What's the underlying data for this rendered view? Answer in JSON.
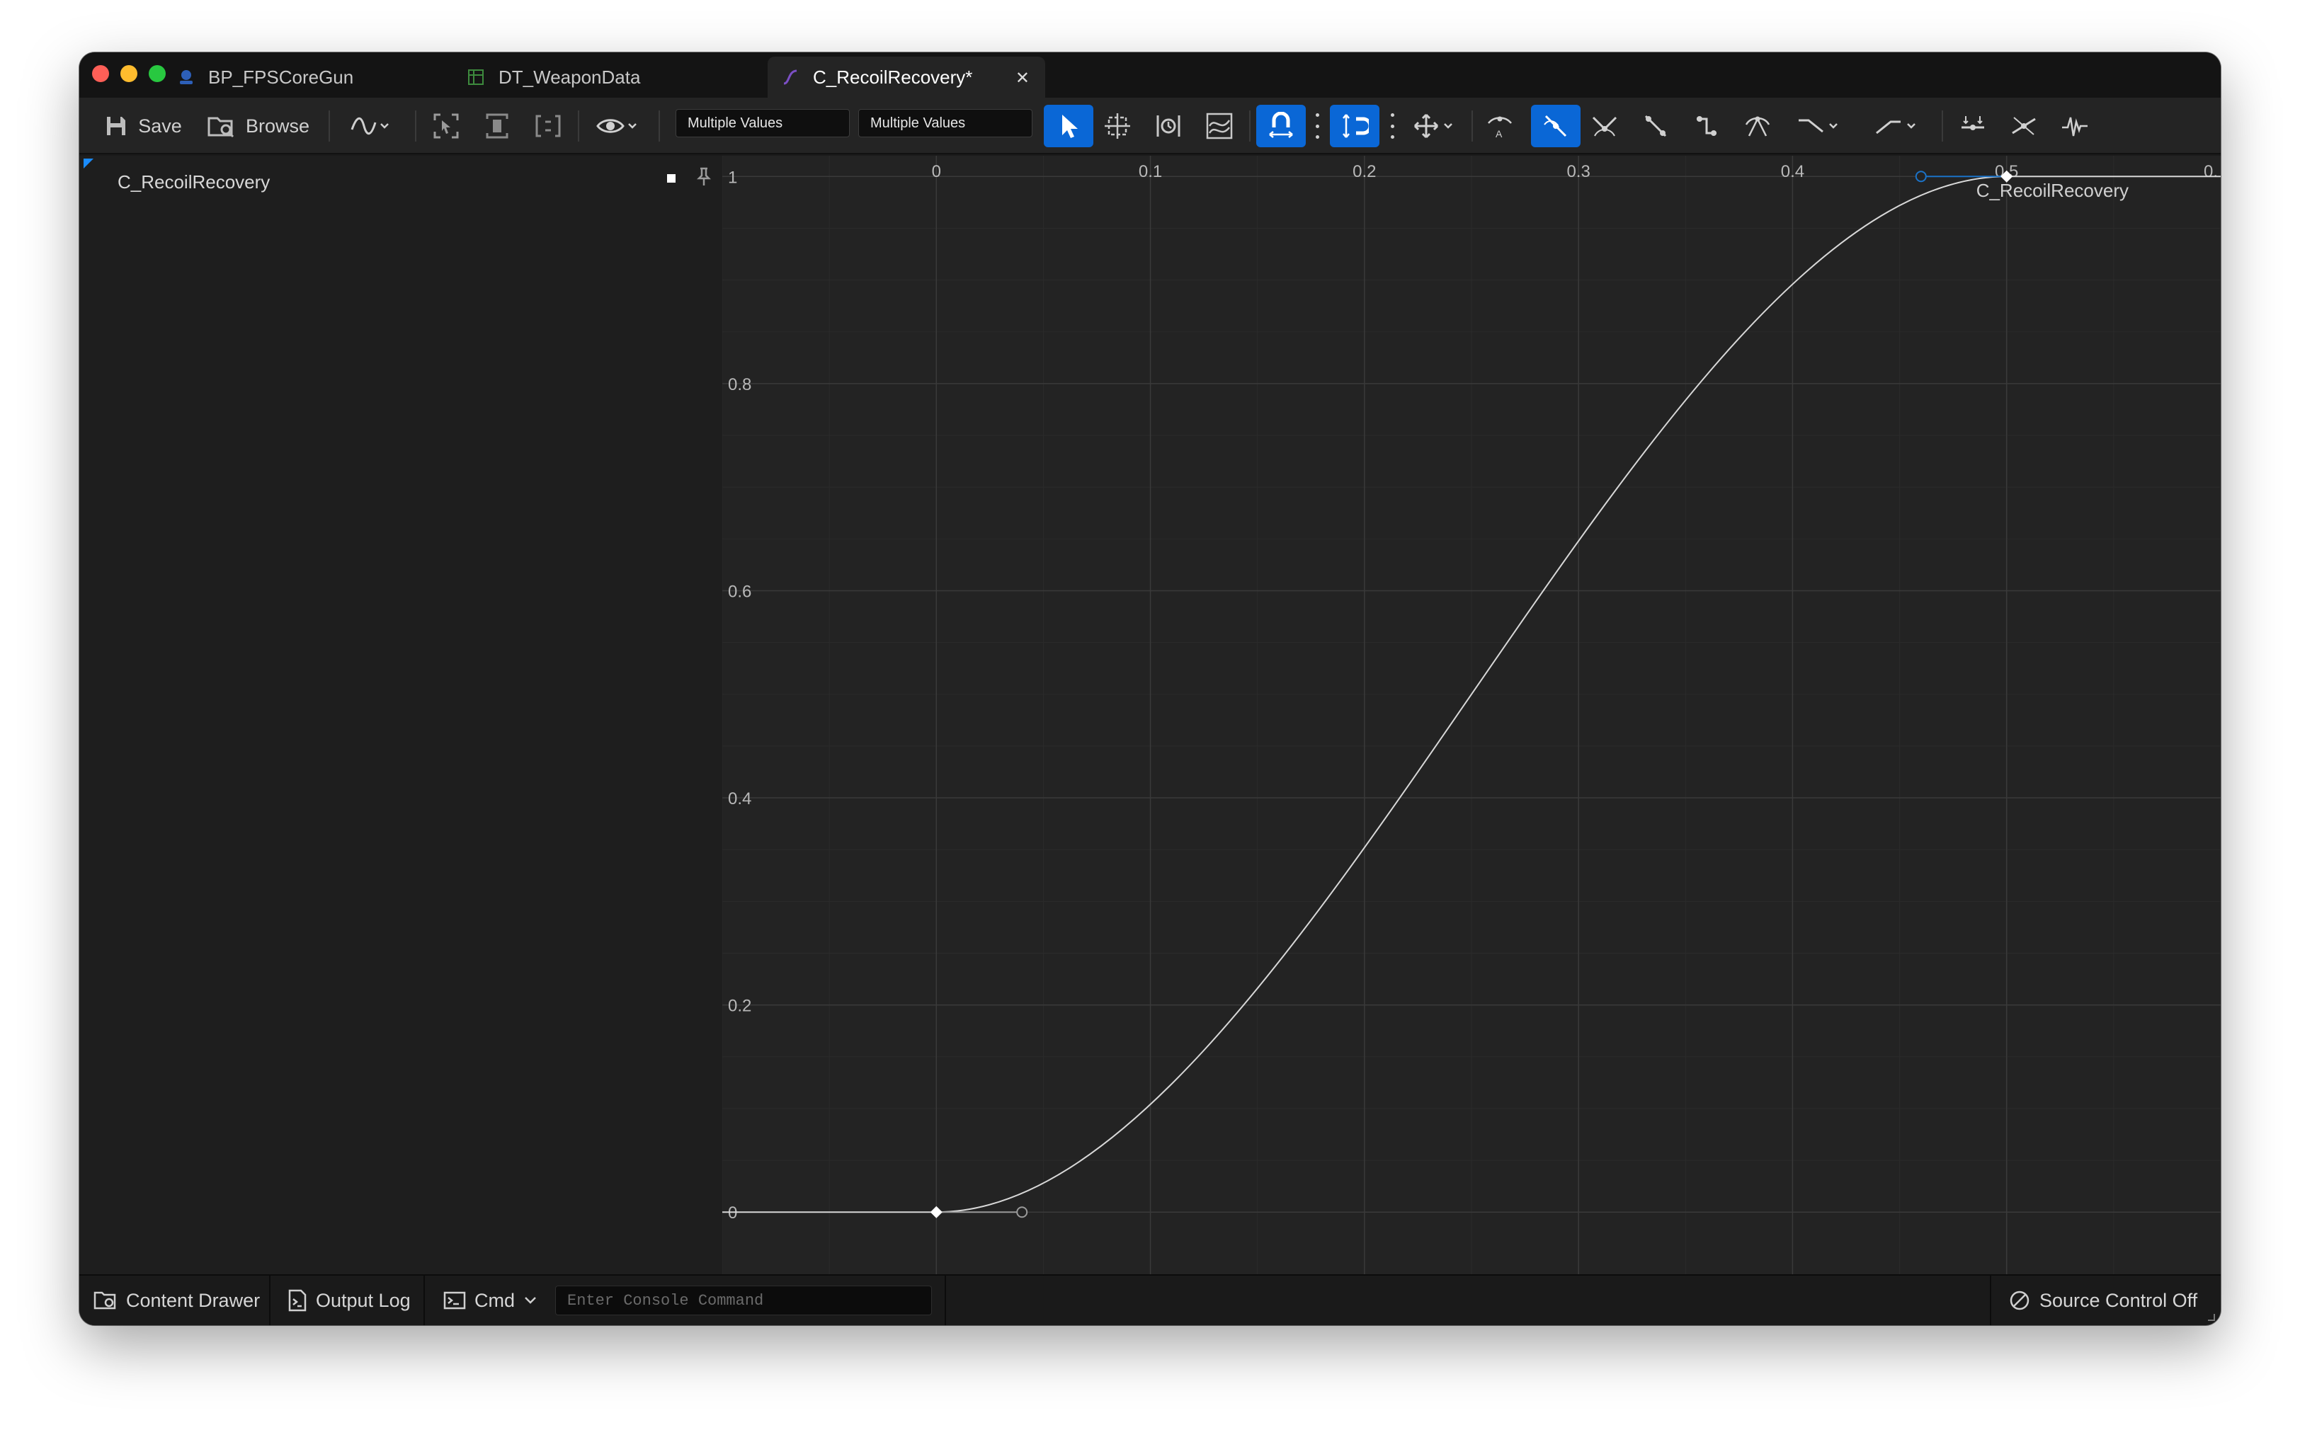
{
  "tabs": [
    {
      "label": "BP_FPSCoreGun",
      "icon": "blueprint-icon",
      "active": false
    },
    {
      "label": "DT_WeaponData",
      "icon": "datatable-icon",
      "active": false
    },
    {
      "label": "C_RecoilRecovery*",
      "icon": "curve-icon",
      "active": true
    }
  ],
  "toolbar": {
    "save_label": "Save",
    "browse_label": "Browse",
    "field1_value": "Multiple Values",
    "field2_value": "Multiple Values"
  },
  "left_panel": {
    "curve_name": "C_RecoilRecovery"
  },
  "graph": {
    "curve_label": "C_RecoilRecovery",
    "x_tick_labels": [
      "0",
      "0.1",
      "0.2",
      "0.3",
      "0.4",
      "0.5",
      "0."
    ],
    "y_tick_labels": [
      "0",
      "0.2",
      "0.4",
      "0.6",
      "0.8",
      "1"
    ]
  },
  "chart_data": {
    "type": "line",
    "series": [
      {
        "name": "C_RecoilRecovery",
        "keys": [
          {
            "time": 0.0,
            "value": 0.0,
            "tangent_handle": {
              "time": 0.04,
              "value": 0.0
            }
          },
          {
            "time": 0.5,
            "value": 1.0,
            "tangent_handle": {
              "time": 0.46,
              "value": 1.0
            }
          }
        ],
        "interpolation": "cubic"
      }
    ],
    "x_ticks": [
      0,
      0.1,
      0.2,
      0.3,
      0.4,
      0.5
    ],
    "y_ticks": [
      0,
      0.2,
      0.4,
      0.6,
      0.8,
      1
    ],
    "xlim": [
      -0.1,
      0.6
    ],
    "ylim": [
      -0.06,
      1.02
    ],
    "grid": true
  },
  "statusbar": {
    "content_drawer": "Content Drawer",
    "output_log": "Output Log",
    "cmd": "Cmd",
    "console_placeholder": "Enter Console Command",
    "source_control": "Source Control Off"
  },
  "colors": {
    "accent": "#0a67d6",
    "tangent_selected": "#1b73c8",
    "curve": "#d8d8d8"
  }
}
